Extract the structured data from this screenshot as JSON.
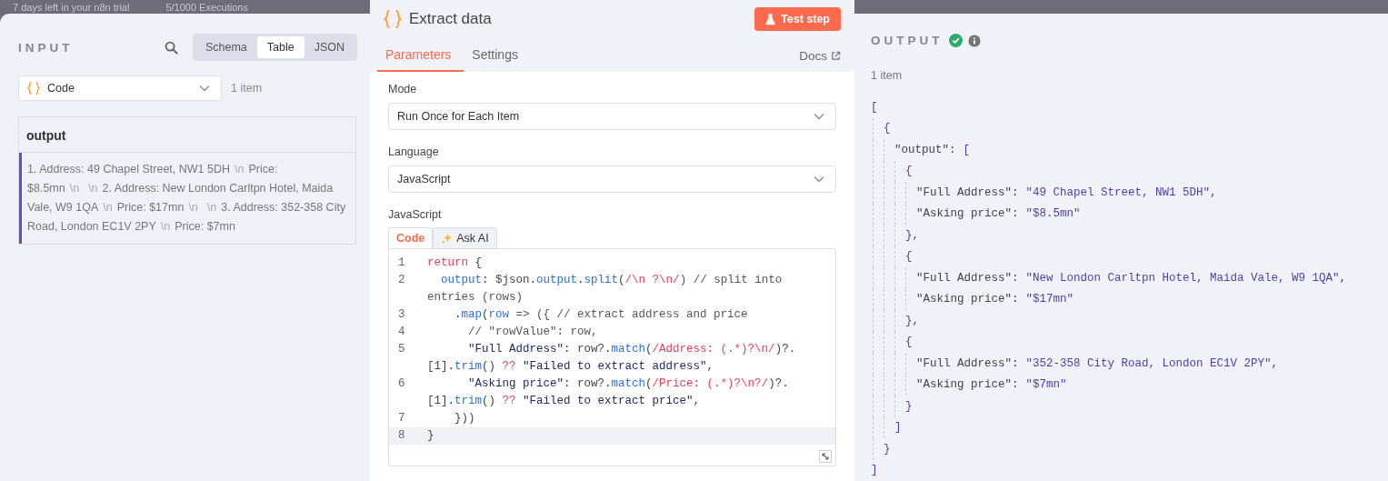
{
  "backdrop": {
    "trial_notice": "7 days left in your n8n trial",
    "executions": "5/1000 Executions"
  },
  "input": {
    "title": "INPUT",
    "views": [
      {
        "label": "Schema",
        "selected": false
      },
      {
        "label": "Table",
        "selected": true
      },
      {
        "label": "JSON",
        "selected": false
      }
    ],
    "source": {
      "value": "Code"
    },
    "count": "1 item",
    "table": {
      "columns": [
        "output"
      ],
      "rows": [
        [
          [
            {
              "text": "1. Address: 49 Chapel Street, NW1 5DH",
              "kind": "text"
            },
            {
              "text": "\\n",
              "kind": "escape"
            },
            {
              "text": "Price: $8.5mn",
              "kind": "text"
            },
            {
              "text": "\\n",
              "kind": "escape"
            },
            {
              "text": "\\n",
              "kind": "escape"
            },
            {
              "text": "2. Address: New London Carltpn Hotel, Maida Vale, W9 1QA",
              "kind": "text"
            },
            {
              "text": "\\n",
              "kind": "escape"
            },
            {
              "text": "Price: $17mn",
              "kind": "text"
            },
            {
              "text": "\\n",
              "kind": "escape"
            },
            {
              "text": "\\n",
              "kind": "escape"
            },
            {
              "text": "3. Address: 352-358 City Road, London EC1V 2PY",
              "kind": "text"
            },
            {
              "text": "\\n",
              "kind": "escape"
            },
            {
              "text": "Price: $7mn",
              "kind": "text"
            }
          ]
        ]
      ]
    }
  },
  "node": {
    "title": "Extract data",
    "test_button": "Test step",
    "tabs": [
      {
        "label": "Parameters",
        "selected": true
      },
      {
        "label": "Settings",
        "selected": false
      }
    ],
    "docs": "Docs",
    "fields": [
      {
        "label": "Mode",
        "value": "Run Once for Each Item"
      },
      {
        "label": "Language",
        "value": "JavaScript"
      }
    ],
    "editor": {
      "label": "JavaScript",
      "tabs": [
        {
          "label": "Code",
          "selected": true
        },
        {
          "label": "Ask AI",
          "selected": false
        }
      ],
      "lines": [
        {
          "number": "1",
          "current": false,
          "tokens": [
            {
              "text": "return",
              "kind": "keyword"
            },
            {
              "text": " {",
              "kind": "plain"
            }
          ]
        },
        {
          "number": "2",
          "current": false,
          "tokens": [
            {
              "text": "  output",
              "kind": "prop"
            },
            {
              "text": ": $json.",
              "kind": "plain"
            },
            {
              "text": "output",
              "kind": "prop"
            },
            {
              "text": ".",
              "kind": "plain"
            },
            {
              "text": "split",
              "kind": "prop"
            },
            {
              "text": "(",
              "kind": "plain"
            },
            {
              "text": "/\\n ?\\n/",
              "kind": "regex"
            },
            {
              "text": ") // split into entries (rows)",
              "kind": "comment"
            }
          ]
        },
        {
          "number": "3",
          "current": false,
          "tokens": [
            {
              "text": "    .",
              "kind": "plain"
            },
            {
              "text": "map",
              "kind": "prop"
            },
            {
              "text": "(",
              "kind": "plain"
            },
            {
              "text": "row",
              "kind": "prop"
            },
            {
              "text": " => ({ // extract address and price",
              "kind": "comment"
            }
          ]
        },
        {
          "number": "4",
          "current": false,
          "tokens": [
            {
              "text": "      // \"rowValue\": row,",
              "kind": "comment"
            }
          ]
        },
        {
          "number": "5",
          "current": false,
          "tokens": [
            {
              "text": "      \"Full Address\"",
              "kind": "string"
            },
            {
              "text": ": row?.",
              "kind": "plain"
            },
            {
              "text": "match",
              "kind": "prop"
            },
            {
              "text": "(",
              "kind": "plain"
            },
            {
              "text": "/Address: (.*)?\\n/",
              "kind": "regex"
            },
            {
              "text": ")?.[1].",
              "kind": "plain"
            },
            {
              "text": "trim",
              "kind": "prop"
            },
            {
              "text": "() ",
              "kind": "plain"
            },
            {
              "text": "??",
              "kind": "keyword"
            },
            {
              "text": " \"Failed to extract address\"",
              "kind": "string"
            },
            {
              "text": ",",
              "kind": "plain"
            }
          ]
        },
        {
          "number": "6",
          "current": false,
          "tokens": [
            {
              "text": "      \"Asking price\"",
              "kind": "string"
            },
            {
              "text": ": row?.",
              "kind": "plain"
            },
            {
              "text": "match",
              "kind": "prop"
            },
            {
              "text": "(",
              "kind": "plain"
            },
            {
              "text": "/Price: (.*)?\\n?/",
              "kind": "regex"
            },
            {
              "text": ")?.[1].",
              "kind": "plain"
            },
            {
              "text": "trim",
              "kind": "prop"
            },
            {
              "text": "() ",
              "kind": "plain"
            },
            {
              "text": "??",
              "kind": "keyword"
            },
            {
              "text": " \"Failed to extract price\"",
              "kind": "string"
            },
            {
              "text": ",",
              "kind": "plain"
            }
          ]
        },
        {
          "number": "7",
          "current": false,
          "tokens": [
            {
              "text": "    }))",
              "kind": "plain"
            }
          ]
        },
        {
          "number": "8",
          "current": true,
          "tokens": [
            {
              "text": "}",
              "kind": "plain"
            }
          ]
        }
      ]
    }
  },
  "output": {
    "title": "OUTPUT",
    "success": true,
    "count": "1 item",
    "json": [
      {
        "tokens": [
          {
            "text": "[",
            "kind": "punct"
          }
        ],
        "children": [
          {
            "tokens": [
              {
                "text": "{",
                "kind": "punct"
              }
            ],
            "children": [
              {
                "tokens": [
                  {
                    "text": "\"output\"",
                    "kind": "key"
                  },
                  {
                    "text": ":",
                    "kind": "plain"
                  },
                  {
                    "text": "[",
                    "kind": "punct"
                  }
                ],
                "children": [
                  {
                    "tokens": [
                      {
                        "text": "{",
                        "kind": "punct"
                      }
                    ],
                    "children": [
                      {
                        "tokens": [
                          {
                            "text": "\"Full Address\"",
                            "kind": "key"
                          },
                          {
                            "text": ":",
                            "kind": "plain"
                          },
                          {
                            "text": "\"49 Chapel Street, NW1 5DH\"",
                            "kind": "value"
                          },
                          {
                            "text": ",",
                            "kind": "plain"
                          }
                        ]
                      },
                      {
                        "tokens": [
                          {
                            "text": "\"Asking price\"",
                            "kind": "key"
                          },
                          {
                            "text": ":",
                            "kind": "plain"
                          },
                          {
                            "text": "\"$8.5mn\"",
                            "kind": "value"
                          }
                        ]
                      }
                    ]
                  },
                  {
                    "tokens": [
                      {
                        "text": "},",
                        "kind": "punct"
                      }
                    ]
                  },
                  {
                    "tokens": [
                      {
                        "text": "{",
                        "kind": "punct"
                      }
                    ],
                    "children": [
                      {
                        "tokens": [
                          {
                            "text": "\"Full Address\"",
                            "kind": "key"
                          },
                          {
                            "text": ":",
                            "kind": "plain"
                          },
                          {
                            "text": "\"New London Carltpn Hotel, Maida Vale, W9 1QA\"",
                            "kind": "value"
                          },
                          {
                            "text": ",",
                            "kind": "plain"
                          }
                        ]
                      },
                      {
                        "tokens": [
                          {
                            "text": "\"Asking price\"",
                            "kind": "key"
                          },
                          {
                            "text": ":",
                            "kind": "plain"
                          },
                          {
                            "text": "\"$17mn\"",
                            "kind": "value"
                          }
                        ]
                      }
                    ]
                  },
                  {
                    "tokens": [
                      {
                        "text": "},",
                        "kind": "punct"
                      }
                    ]
                  },
                  {
                    "tokens": [
                      {
                        "text": "{",
                        "kind": "punct"
                      }
                    ],
                    "children": [
                      {
                        "tokens": [
                          {
                            "text": "\"Full Address\"",
                            "kind": "key"
                          },
                          {
                            "text": ":",
                            "kind": "plain"
                          },
                          {
                            "text": "\"352-358 City Road, London EC1V 2PY\"",
                            "kind": "value"
                          },
                          {
                            "text": ",",
                            "kind": "plain"
                          }
                        ]
                      },
                      {
                        "tokens": [
                          {
                            "text": "\"Asking price\"",
                            "kind": "key"
                          },
                          {
                            "text": ":",
                            "kind": "plain"
                          },
                          {
                            "text": "\"$7mn\"",
                            "kind": "value"
                          }
                        ]
                      }
                    ]
                  },
                  {
                    "tokens": [
                      {
                        "text": "}",
                        "kind": "punct"
                      }
                    ]
                  }
                ]
              },
              {
                "tokens": [
                  {
                    "text": "]",
                    "kind": "punct"
                  }
                ]
              }
            ]
          },
          {
            "tokens": [
              {
                "text": "}",
                "kind": "punct"
              }
            ]
          }
        ]
      },
      {
        "tokens": [
          {
            "text": "]",
            "kind": "punct"
          }
        ]
      }
    ]
  }
}
